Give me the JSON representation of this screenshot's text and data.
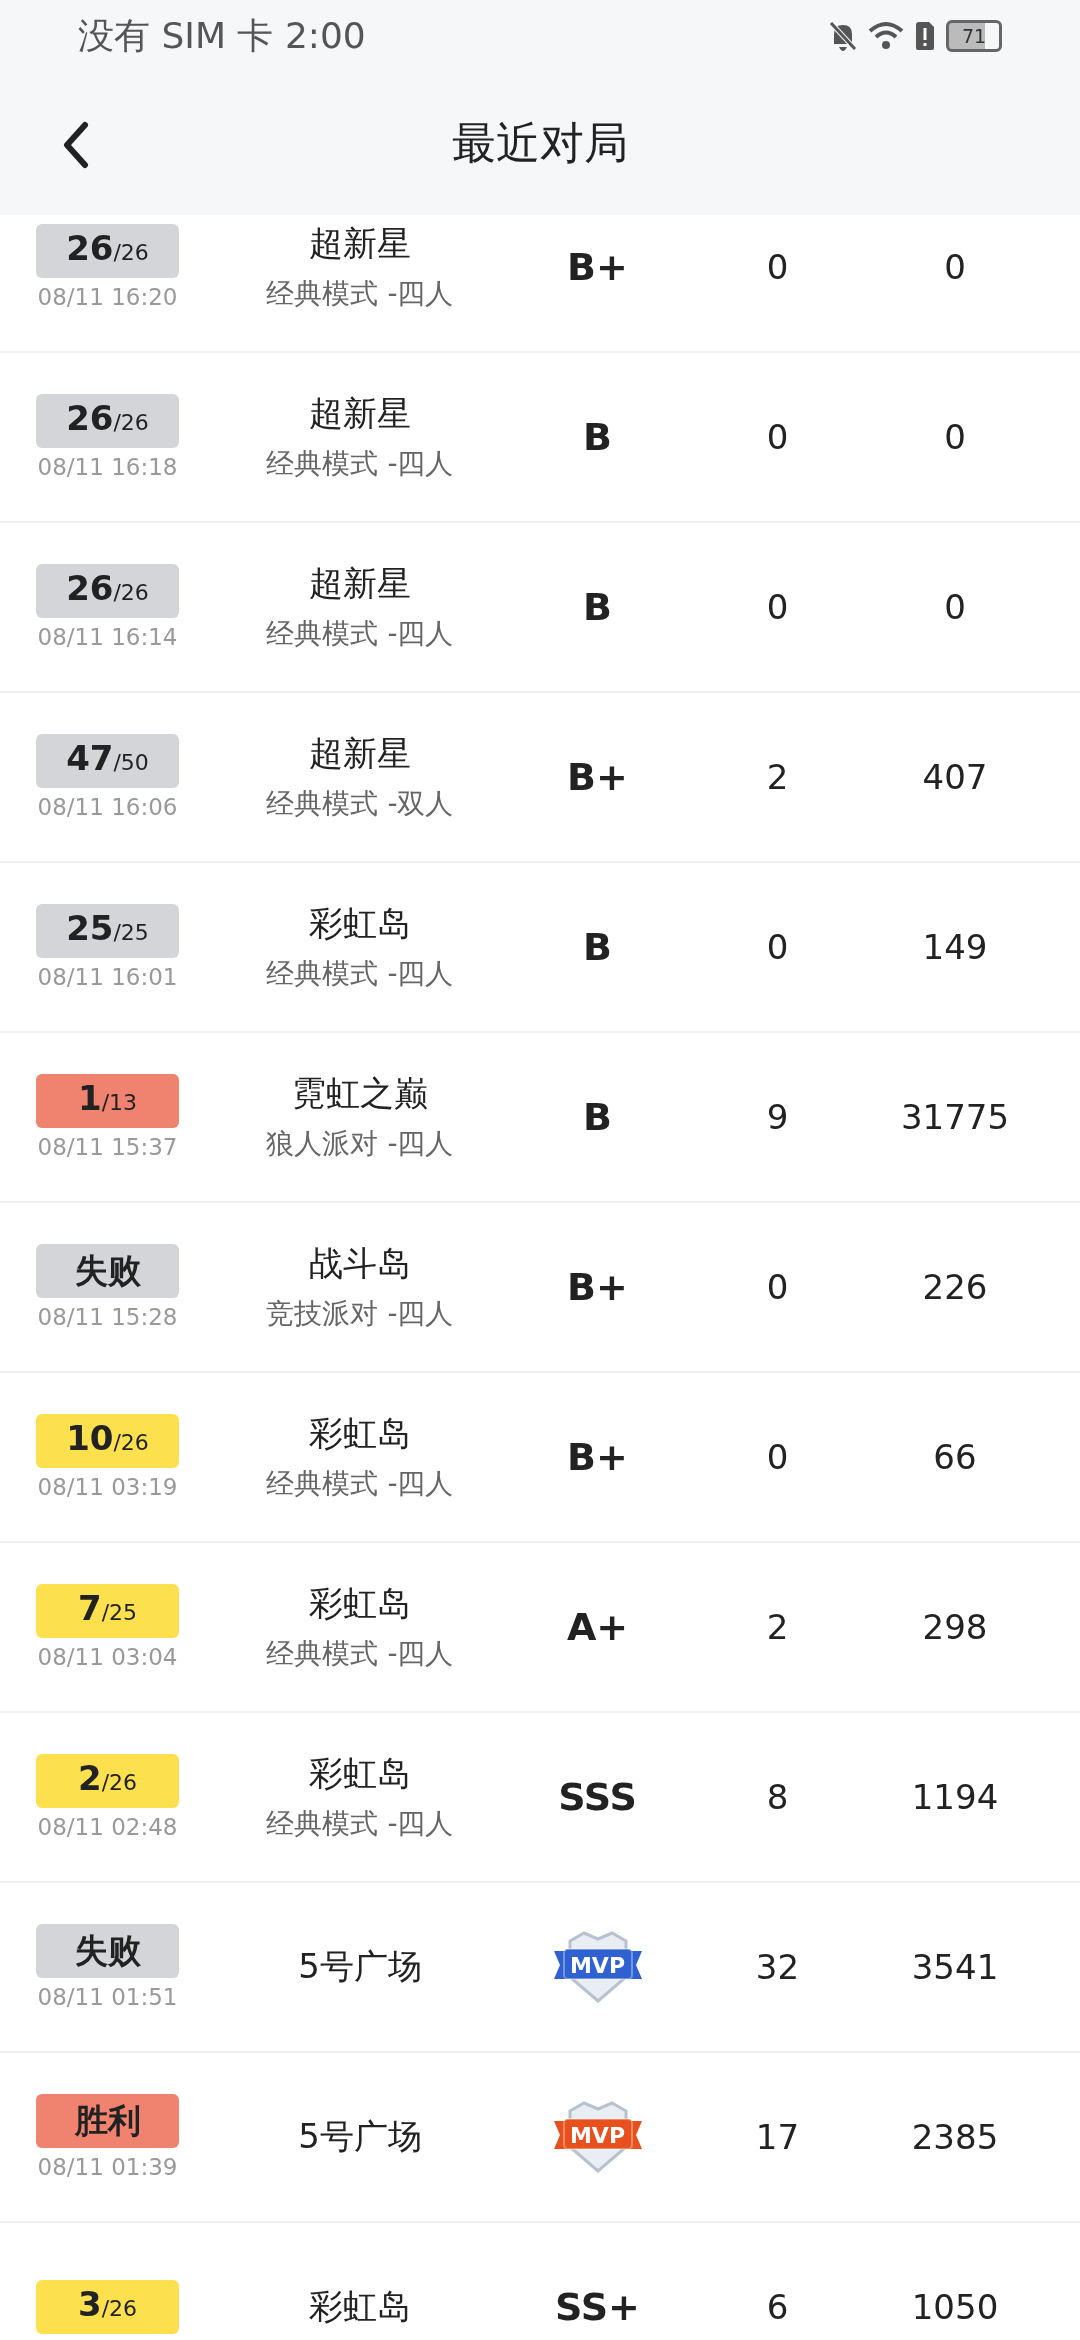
{
  "status_bar": {
    "carrier": "没有 SIM 卡",
    "time": "2:00",
    "battery": "71"
  },
  "header": {
    "title": "最近对局"
  },
  "rows": [
    {
      "badge": {
        "kind": "rank",
        "rank": "26",
        "total": "/26",
        "color": "#d3d5d9"
      },
      "date": "08/11 16:20",
      "map": "超新星",
      "mode": "经典模式 -四人",
      "grade": {
        "kind": "text",
        "text": "B+"
      },
      "column_4": "0",
      "column_5": "0"
    },
    {
      "badge": {
        "kind": "rank",
        "rank": "26",
        "total": "/26",
        "color": "#d3d5d9"
      },
      "date": "08/11 16:18",
      "map": "超新星",
      "mode": "经典模式 -四人",
      "grade": {
        "kind": "text",
        "text": "B"
      },
      "column_4": "0",
      "column_5": "0"
    },
    {
      "badge": {
        "kind": "rank",
        "rank": "26",
        "total": "/26",
        "color": "#d3d5d9"
      },
      "date": "08/11 16:14",
      "map": "超新星",
      "mode": "经典模式 -四人",
      "grade": {
        "kind": "text",
        "text": "B"
      },
      "column_4": "0",
      "column_5": "0"
    },
    {
      "badge": {
        "kind": "rank",
        "rank": "47",
        "total": "/50",
        "color": "#d3d5d9"
      },
      "date": "08/11 16:06",
      "map": "超新星",
      "mode": "经典模式 -双人",
      "grade": {
        "kind": "text",
        "text": "B+"
      },
      "column_4": "2",
      "column_5": "407"
    },
    {
      "badge": {
        "kind": "rank",
        "rank": "25",
        "total": "/25",
        "color": "#d3d5d9"
      },
      "date": "08/11 16:01",
      "map": "彩虹岛",
      "mode": "经典模式 -四人",
      "grade": {
        "kind": "text",
        "text": "B"
      },
      "column_4": "0",
      "column_5": "149"
    },
    {
      "badge": {
        "kind": "rank",
        "rank": "1",
        "total": "/13",
        "color": "#ef8370"
      },
      "date": "08/11 15:37",
      "map": "霓虹之巅",
      "mode": "狼人派对 -四人",
      "grade": {
        "kind": "text",
        "text": "B"
      },
      "column_4": "9",
      "column_5": "31775"
    },
    {
      "badge": {
        "kind": "result",
        "text": "失败",
        "color": "#d3d5d9"
      },
      "date": "08/11 15:28",
      "map": "战斗岛",
      "mode": "竞技派对 -四人",
      "grade": {
        "kind": "text",
        "text": "B+"
      },
      "column_4": "0",
      "column_5": "226"
    },
    {
      "badge": {
        "kind": "rank",
        "rank": "10",
        "total": "/26",
        "color": "#fde04e"
      },
      "date": "08/11 03:19",
      "map": "彩虹岛",
      "mode": "经典模式 -四人",
      "grade": {
        "kind": "text",
        "text": "B+"
      },
      "column_4": "0",
      "column_5": "66"
    },
    {
      "badge": {
        "kind": "rank",
        "rank": "7",
        "total": "/25",
        "color": "#fde04e"
      },
      "date": "08/11 03:04",
      "map": "彩虹岛",
      "mode": "经典模式 -四人",
      "grade": {
        "kind": "text",
        "text": "A+"
      },
      "column_4": "2",
      "column_5": "298"
    },
    {
      "badge": {
        "kind": "rank",
        "rank": "2",
        "total": "/26",
        "color": "#fde04e"
      },
      "date": "08/11 02:48",
      "map": "彩虹岛",
      "mode": "经典模式 -四人",
      "grade": {
        "kind": "text",
        "text": "SSS"
      },
      "column_4": "8",
      "column_5": "1194"
    },
    {
      "badge": {
        "kind": "result",
        "text": "失败",
        "color": "#d3d5d9"
      },
      "date": "08/11 01:51",
      "map": "5号广场",
      "grade": {
        "kind": "mvp",
        "text": "MVP",
        "color": "#2f62d0"
      },
      "column_4": "32",
      "column_5": "3541"
    },
    {
      "badge": {
        "kind": "result",
        "text": "胜利",
        "color": "#ef8370"
      },
      "date": "08/11 01:39",
      "map": "5号广场",
      "grade": {
        "kind": "mvp",
        "text": "MVP",
        "color": "#e8501e"
      },
      "column_4": "17",
      "column_5": "2385"
    },
    {
      "badge": {
        "kind": "rank",
        "rank": "3",
        "total": "/26",
        "color": "#fde04e"
      },
      "map": "彩虹岛",
      "grade": {
        "kind": "text",
        "text": "SS+"
      },
      "column_4": "6",
      "column_5": "1050"
    }
  ]
}
